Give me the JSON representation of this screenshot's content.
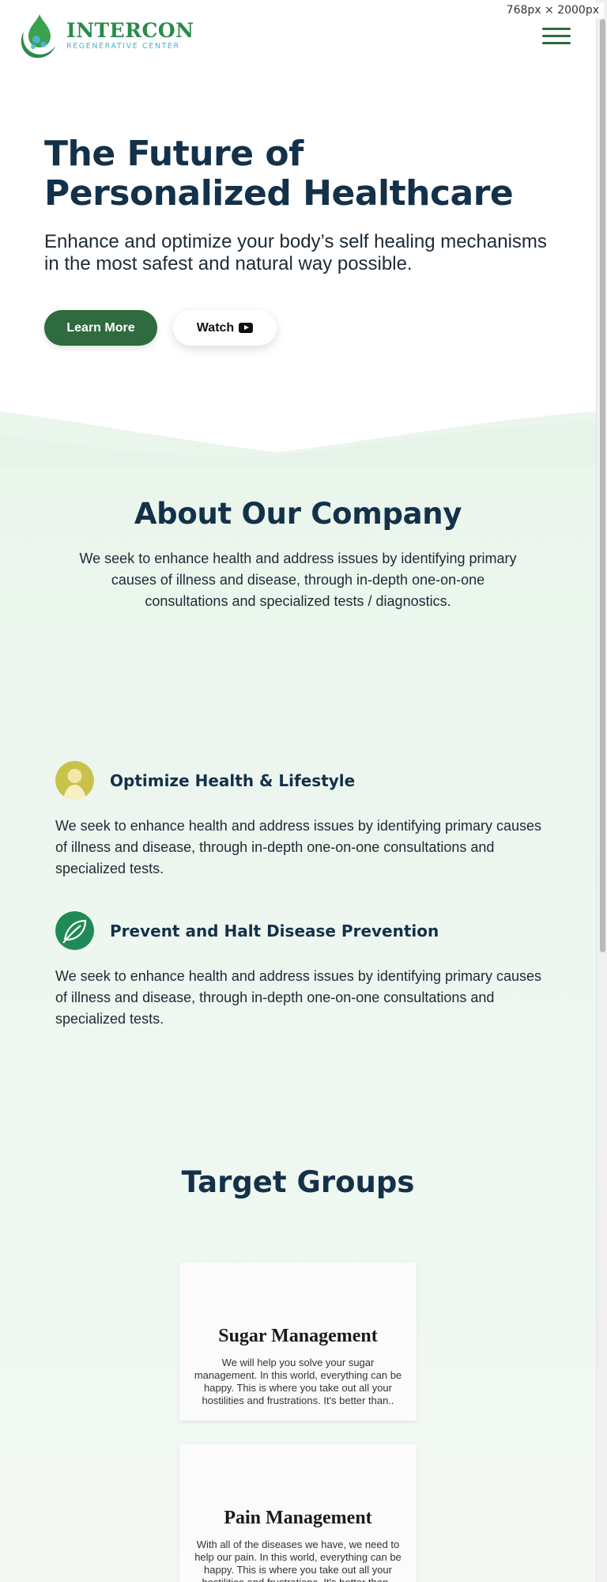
{
  "viewport_badge": "768px × 2000px",
  "header": {
    "logo_name": "INTERCON",
    "logo_tagline": "REGENERATIVE CENTER"
  },
  "hero": {
    "title": "The Future of Personalized Healthcare",
    "subtitle": "Enhance and optimize your body’s self healing mechanisms in the most safest and natural way possible.",
    "learn_more_label": "Learn More",
    "watch_label": "Watch"
  },
  "about": {
    "title": "About Our Company",
    "text": "We seek to enhance health and address issues by identifying primary causes of illness and disease, through in-depth one-on-one consultations and specialized tests / diagnostics."
  },
  "features": [
    {
      "icon": "person-icon",
      "title": "Optimize Health & Lifestyle",
      "text": "We seek to enhance health and address issues by identifying primary causes of illness and disease, through in-depth one-on-one consultations and specialized tests."
    },
    {
      "icon": "leaf-icon",
      "title": "Prevent and Halt Disease Prevention",
      "text": "We seek to enhance health and address issues by identifying primary causes of illness and disease, through in-depth one-on-one consultations and specialized tests."
    }
  ],
  "target_groups": {
    "title": "Target Groups",
    "cards": [
      {
        "title": "Sugar Management",
        "text": "We will help you solve your sugar management. In this world, everything can be happy. This is where you take out all your hostilities and frustrations. It's better than.."
      },
      {
        "title": "Pain Management",
        "text": "With all of the diseases we have, we need to help our pain. In this world, everything can be happy. This is where you take out all your hostilities and frustrations. It's better than.."
      }
    ]
  },
  "colors": {
    "brand_green": "#2e6b3f",
    "heading_navy": "#14314a",
    "logo_green": "#2b8a4a",
    "logo_teal": "#4cb6cc",
    "section_bg": "#ecf6ee"
  }
}
